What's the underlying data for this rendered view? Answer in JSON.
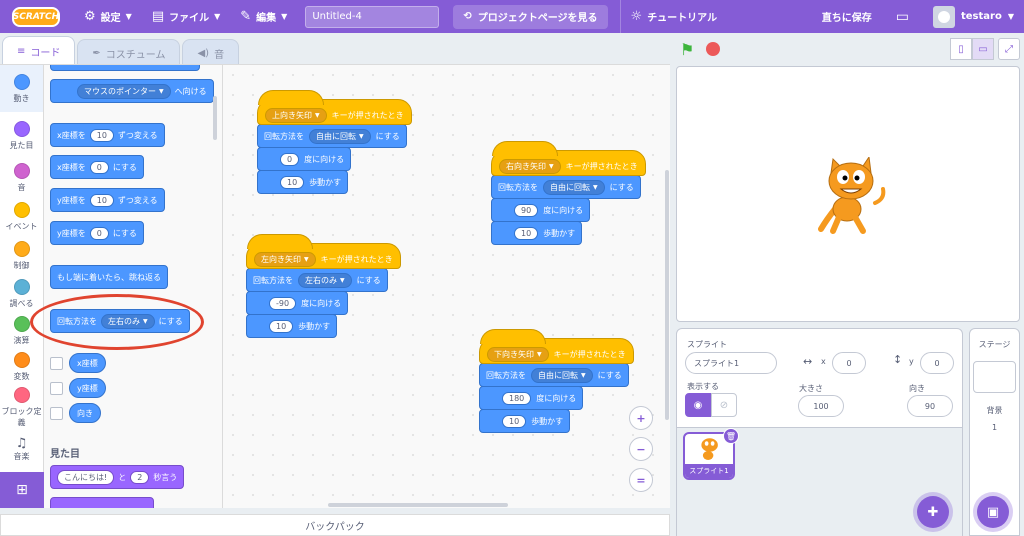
{
  "menu": {
    "logo": "SCRATCH",
    "settings": "設定",
    "file": "ファイル",
    "edit": "編集",
    "project_title": "Untitled-4",
    "project_page": "プロジェクトページを見る",
    "tutorials": "チュートリアル",
    "save_now": "直ちに保存",
    "username": "testaro"
  },
  "tabs": {
    "code": "コード",
    "costumes": "コスチューム",
    "sounds": "音"
  },
  "categories": [
    {
      "label": "動き",
      "color": "#4c97ff"
    },
    {
      "label": "見た目",
      "color": "#9966ff"
    },
    {
      "label": "音",
      "color": "#cf63cf"
    },
    {
      "label": "イベント",
      "color": "#ffbf00"
    },
    {
      "label": "制御",
      "color": "#ffab19"
    },
    {
      "label": "調べる",
      "color": "#5cb1d6"
    },
    {
      "label": "演算",
      "color": "#59c059"
    },
    {
      "label": "変数",
      "color": "#ff8c1a"
    },
    {
      "label": "ブロック定義",
      "color": "#ff6680"
    },
    {
      "label": "音楽",
      "color": "#0fbd8c"
    }
  ],
  "palette": {
    "point_towards": {
      "dd": "マウスのポインター",
      "suffix": "へ向ける"
    },
    "change_x": {
      "pre": "x座標を",
      "val": "10",
      "suf": "ずつ変える"
    },
    "set_x": {
      "pre": "x座標を",
      "val": "0",
      "suf": "にする"
    },
    "change_y": {
      "pre": "y座標を",
      "val": "10",
      "suf": "ずつ変える"
    },
    "set_y": {
      "pre": "y座標を",
      "val": "0",
      "suf": "にする"
    },
    "bounce": "もし端に着いたら、跳ね返る",
    "rotation": {
      "pre": "回転方法を",
      "dd": "左右のみ",
      "suf": "にする"
    },
    "reporters": [
      "x座標",
      "y座標",
      "向き"
    ],
    "looks_title": "見た目",
    "say": {
      "val": "こんにちは!",
      "mid": "と",
      "secs": "2",
      "suf": "秒言う"
    }
  },
  "scripts": {
    "up": {
      "key": "上向き矢印",
      "hat": "キーが押されたとき",
      "rot_pre": "回転方法を",
      "rot_dd": "自由に回転",
      "rot_suf": "にする",
      "dir": "0",
      "dir_suf": "度に向ける",
      "move": "10",
      "move_suf": "歩動かす"
    },
    "right": {
      "key": "右向き矢印",
      "hat": "キーが押されたとき",
      "rot_pre": "回転方法を",
      "rot_dd": "自由に回転",
      "rot_suf": "にする",
      "dir": "90",
      "dir_suf": "度に向ける",
      "move": "10",
      "move_suf": "歩動かす"
    },
    "left": {
      "key": "左向き矢印",
      "hat": "キーが押されたとき",
      "rot_pre": "回転方法を",
      "rot_dd": "左右のみ",
      "rot_suf": "にする",
      "dir": "-90",
      "dir_suf": "度に向ける",
      "move": "10",
      "move_suf": "歩動かす"
    },
    "down": {
      "key": "下向き矢印",
      "hat": "キーが押されたとき",
      "rot_pre": "回転方法を",
      "rot_dd": "自由に回転",
      "rot_suf": "にする",
      "dir": "180",
      "dir_suf": "度に向ける",
      "move": "10",
      "move_suf": "歩動かす"
    }
  },
  "backpack": "バックパック",
  "sprite_info": {
    "sprite_label": "スプライト",
    "sprite_name": "スプライト1",
    "x_label": "x",
    "x_value": "0",
    "y_label": "y",
    "y_value": "0",
    "show_label": "表示する",
    "size_label": "大きさ",
    "size_value": "100",
    "direction_label": "向き",
    "direction_value": "90",
    "thumb_name": "スプライト1"
  },
  "stage_pane": {
    "title": "ステージ",
    "backdrop_label": "背景",
    "backdrop_count": "1"
  },
  "colors": {
    "accent": "#855cd6",
    "motion": "#4c97ff",
    "events": "#ffbf00",
    "annotation": "#e0442f"
  }
}
